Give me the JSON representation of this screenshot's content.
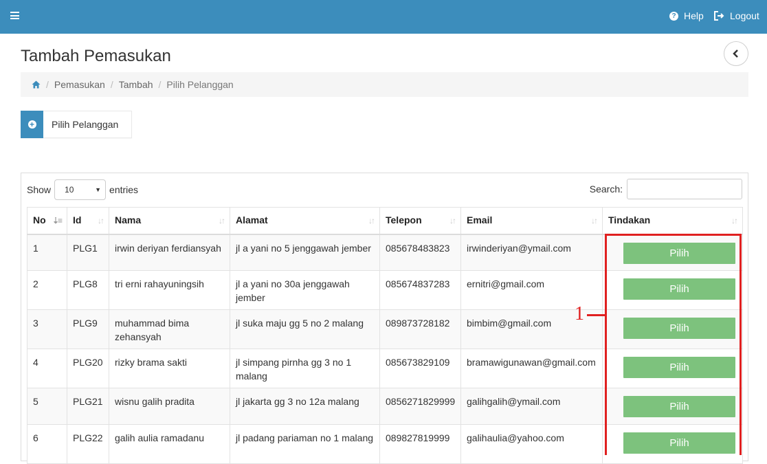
{
  "header": {
    "menu_icon": "hamburger-icon",
    "help_label": "Help",
    "logout_label": "Logout",
    "help_icon": "question-circle-icon",
    "logout_icon": "sign-out-icon",
    "background_color": "#3c8dbc"
  },
  "page": {
    "title": "Tambah Pemasukan",
    "back_icon": "chevron-left-icon"
  },
  "breadcrumb": {
    "home_icon": "home-icon",
    "items": [
      "Pemasukan",
      "Tambah",
      "Pilih Pelanggan"
    ]
  },
  "panel_button": {
    "label": "Pilih Pelanggan",
    "icon": "plus-circle-icon"
  },
  "datatable": {
    "show_label": "Show",
    "entries_label": "entries",
    "page_length": "10",
    "search_label": "Search:",
    "search_value": "",
    "columns": [
      "No",
      "Id",
      "Nama",
      "Alamat",
      "Telepon",
      "Email",
      "Tindakan"
    ],
    "sorted_column": "No",
    "action_label": "Pilih",
    "action_color": "#7dc27d",
    "rows": [
      {
        "no": "1",
        "id": "PLG1",
        "nama": "irwin deriyan ferdiansyah",
        "alamat": "jl a yani no 5 jenggawah jember",
        "telepon": "085678483823",
        "email": "irwinderiyan@ymail.com"
      },
      {
        "no": "2",
        "id": "PLG8",
        "nama": "tri erni rahayuningsih",
        "alamat": "jl a yani no 30a jenggawah jember",
        "telepon": "085674837283",
        "email": "ernitri@gmail.com"
      },
      {
        "no": "3",
        "id": "PLG9",
        "nama": "muhammad bima zehansyah",
        "alamat": "jl suka maju gg 5 no 2 malang",
        "telepon": "089873728182",
        "email": "bimbim@gmail.com"
      },
      {
        "no": "4",
        "id": "PLG20",
        "nama": "rizky brama sakti",
        "alamat": "jl simpang pirnha gg 3 no 1 malang",
        "telepon": "085673829109",
        "email": "bramawigunawan@gmail.com"
      },
      {
        "no": "5",
        "id": "PLG21",
        "nama": "wisnu galih pradita",
        "alamat": "jl jakarta gg 3 no 12a malang",
        "telepon": "0856271829999",
        "email": "galihgalih@ymail.com"
      },
      {
        "no": "6",
        "id": "PLG22",
        "nama": "galih aulia ramadanu",
        "alamat": "jl padang pariaman no 1 malang",
        "telepon": "089827819999",
        "email": "galihaulia@yahoo.com"
      }
    ]
  },
  "annotation": {
    "number": "1",
    "color": "#e02020"
  }
}
